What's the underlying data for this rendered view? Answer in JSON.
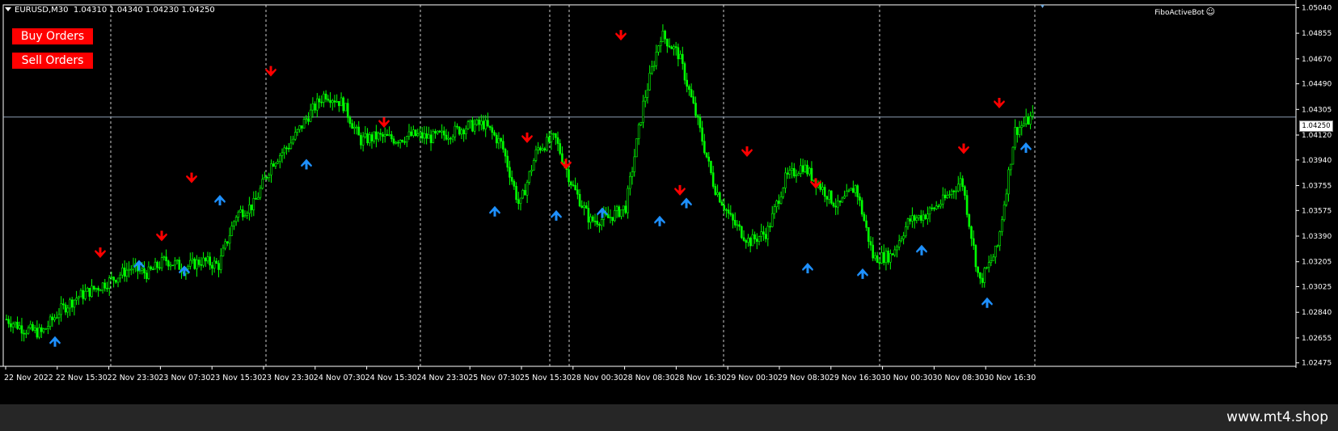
{
  "chart_header": {
    "symbol_timeframe": "EURUSD,M30",
    "ohlc": "1.04310 1.04340 1.04230 1.04250"
  },
  "buttons": {
    "buy_label": "Buy Orders",
    "sell_label": "Sell Orders"
  },
  "indicator": {
    "name": "FiboActiveBot",
    "icon": "smiley-icon"
  },
  "price_axis": {
    "ticks": [
      "1.05040",
      "1.04855",
      "1.04670",
      "1.04490",
      "1.04305",
      "1.04120",
      "1.03940",
      "1.03755",
      "1.03575",
      "1.03390",
      "1.03205",
      "1.03025",
      "1.02840",
      "1.02655",
      "1.02475"
    ],
    "current_price": "1.04250",
    "range": [
      1.0245,
      1.0506
    ]
  },
  "time_axis": {
    "labels": [
      "22 Nov 2022",
      "22 Nov 15:30",
      "22 Nov 23:30",
      "23 Nov 07:30",
      "23 Nov 15:30",
      "23 Nov 23:30",
      "24 Nov 07:30",
      "24 Nov 15:30",
      "24 Nov 23:30",
      "25 Nov 07:30",
      "25 Nov 15:30",
      "28 Nov 00:30",
      "28 Nov 08:30",
      "28 Nov 16:30",
      "29 Nov 00:30",
      "29 Nov 08:30",
      "29 Nov 16:30",
      "30 Nov 00:30",
      "30 Nov 08:30",
      "30 Nov 16:30"
    ]
  },
  "colors": {
    "background": "#000000",
    "candle": "#00ff00",
    "sell_arrow": "#ff0000",
    "buy_arrow": "#1e90ff",
    "grid": "#ffffff",
    "button": "#ff0000",
    "footer": "#262626"
  },
  "chart_data": {
    "type": "candlestick",
    "symbol": "EURUSD",
    "timeframe": "M30",
    "x": [
      "22 Nov 2022",
      "22 Nov 15:30",
      "22 Nov 23:30",
      "23 Nov 07:30",
      "23 Nov 15:30",
      "23 Nov 23:30",
      "24 Nov 07:30",
      "24 Nov 15:30",
      "24 Nov 23:30",
      "25 Nov 07:30",
      "25 Nov 15:30",
      "28 Nov 00:30",
      "28 Nov 08:30",
      "28 Nov 16:30",
      "29 Nov 00:30",
      "29 Nov 08:30",
      "29 Nov 16:30",
      "30 Nov 00:30",
      "30 Nov 08:30",
      "30 Nov 16:30"
    ],
    "close_path": [
      1.0279,
      1.0272,
      1.0269,
      1.0285,
      1.0295,
      1.0301,
      1.0308,
      1.0316,
      1.0312,
      1.0322,
      1.0316,
      1.0321,
      1.0318,
      1.0355,
      1.0362,
      1.0392,
      1.0405,
      1.0425,
      1.0442,
      1.0435,
      1.0408,
      1.0411,
      1.0409,
      1.0412,
      1.041,
      1.0413,
      1.0418,
      1.042,
      1.0405,
      1.036,
      1.0402,
      1.041,
      1.0375,
      1.035,
      1.0352,
      1.036,
      1.0435,
      1.0485,
      1.047,
      1.0425,
      1.0375,
      1.035,
      1.0335,
      1.0342,
      1.038,
      1.039,
      1.0375,
      1.036,
      1.0375,
      1.0323,
      1.0325,
      1.035,
      1.0355,
      1.0365,
      1.038,
      1.0305,
      1.033,
      1.0415,
      1.0425
    ],
    "sell_signals": [
      [
        1.0325,
        1.0337,
        1.0379,
        1.0456,
        1.0419,
        1.0408,
        1.0389,
        1.0482,
        1.037,
        1.0398,
        1.0375,
        1.04,
        1.0433
      ]
    ],
    "buy_signals": [
      [
        1.0265,
        1.032,
        1.0316,
        1.0367,
        1.0393,
        1.0359,
        1.0356,
        1.0358,
        1.0352,
        1.0365,
        1.0318,
        1.0314,
        1.0331,
        1.0293,
        1.0405
      ]
    ],
    "current_price": 1.0425,
    "ylim": [
      1.0245,
      1.0506
    ],
    "grid": "vertical dashed at session starts"
  },
  "footer": {
    "watermark": "www.mt4.shop"
  }
}
